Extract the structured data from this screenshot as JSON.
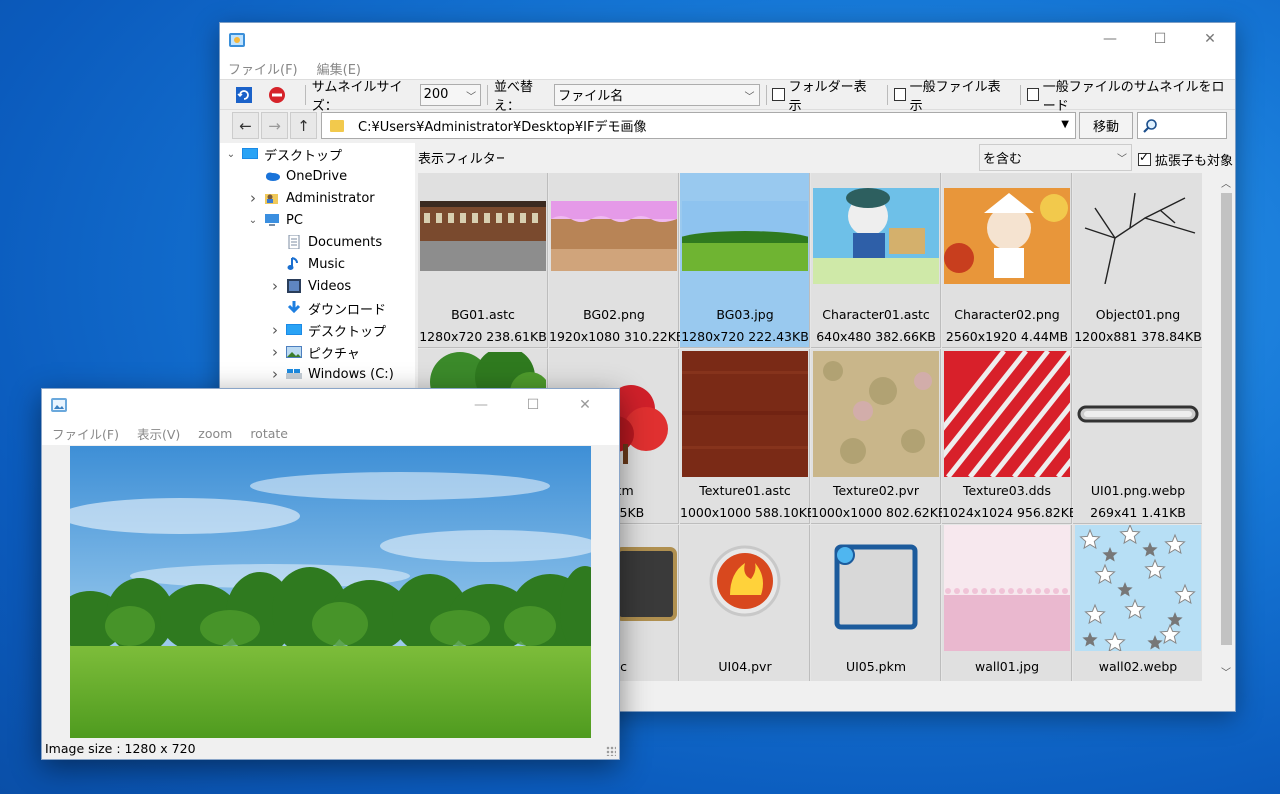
{
  "main_window": {
    "menu": [
      "ファイル(F)",
      "編集(E)"
    ],
    "toolbar": {
      "thumb_size_label": "サムネイルサイズ：",
      "thumb_size_value": "200",
      "sort_label": "並べ替え：",
      "sort_value": "ファイル名",
      "show_folders": "フォルダー表示",
      "show_general": "一般ファイル表示",
      "load_general_thumbs": "一般ファイルのサムネイルをロード"
    },
    "address": {
      "path": "C:¥Users¥Administrator¥Desktop¥IFデモ画像",
      "go_label": "移動"
    },
    "filter": {
      "label": "表示フィルター：",
      "mode": "を含む",
      "include_ext": "拡張子も対象",
      "include_ext_checked": true
    },
    "tree": [
      {
        "label": "デスクトップ",
        "icon": "desktop-icon",
        "expander": "expanded"
      },
      {
        "label": "OneDrive",
        "icon": "cloud-icon",
        "expander": ""
      },
      {
        "label": "Administrator",
        "icon": "user-folder-icon",
        "expander": "collapsed"
      },
      {
        "label": "PC",
        "icon": "computer-icon",
        "expander": "expanded"
      },
      {
        "label": "Documents",
        "icon": "document-icon",
        "expander": ""
      },
      {
        "label": "Music",
        "icon": "music-icon",
        "expander": ""
      },
      {
        "label": "Videos",
        "icon": "video-icon",
        "expander": "collapsed"
      },
      {
        "label": "ダウンロード",
        "icon": "download-icon",
        "expander": ""
      },
      {
        "label": "デスクトップ",
        "icon": "desktop-icon",
        "expander": "collapsed"
      },
      {
        "label": "ピクチャ",
        "icon": "pictures-icon",
        "expander": "collapsed"
      },
      {
        "label": "Windows (C:)",
        "icon": "drive-icon",
        "expander": "collapsed"
      }
    ],
    "files": [
      {
        "name": "BG01.astc",
        "info": "1280x720 238.61KB"
      },
      {
        "name": "BG02.png",
        "info": "1920x1080 310.22KB"
      },
      {
        "name": "BG03.jpg",
        "info": "1280x720 222.43KB",
        "selected": true
      },
      {
        "name": "Character01.astc",
        "info": "640x480 382.66KB"
      },
      {
        "name": "Character02.png",
        "info": "2560x1920 4.44MB"
      },
      {
        "name": "Object01.png",
        "info": "1200x881 378.84KB"
      },
      {
        "name": "",
        "info": ""
      },
      {
        "name": "3.pkm",
        "info": "521.05KB"
      },
      {
        "name": "Texture01.astc",
        "info": "1000x1000 588.10KB"
      },
      {
        "name": "Texture02.pvr",
        "info": "1000x1000 802.62KB"
      },
      {
        "name": "Texture03.dds",
        "info": "1024x1024 956.82KB"
      },
      {
        "name": "UI01.png.webp",
        "info": "269x41 1.41KB"
      },
      {
        "name": "",
        "info": ""
      },
      {
        "name": "astc",
        "info": ""
      },
      {
        "name": "UI04.pvr",
        "info": ""
      },
      {
        "name": "UI05.pkm",
        "info": ""
      },
      {
        "name": "wall01.jpg",
        "info": ""
      },
      {
        "name": "wall02.webp",
        "info": ""
      }
    ]
  },
  "viewer_window": {
    "menu": [
      "ファイル(F)",
      "表示(V)",
      "zoom",
      "rotate"
    ],
    "status": "Image size : 1280 x 720"
  },
  "colors": {
    "selection": "#99c9ef",
    "desktop": "#1677d6"
  }
}
